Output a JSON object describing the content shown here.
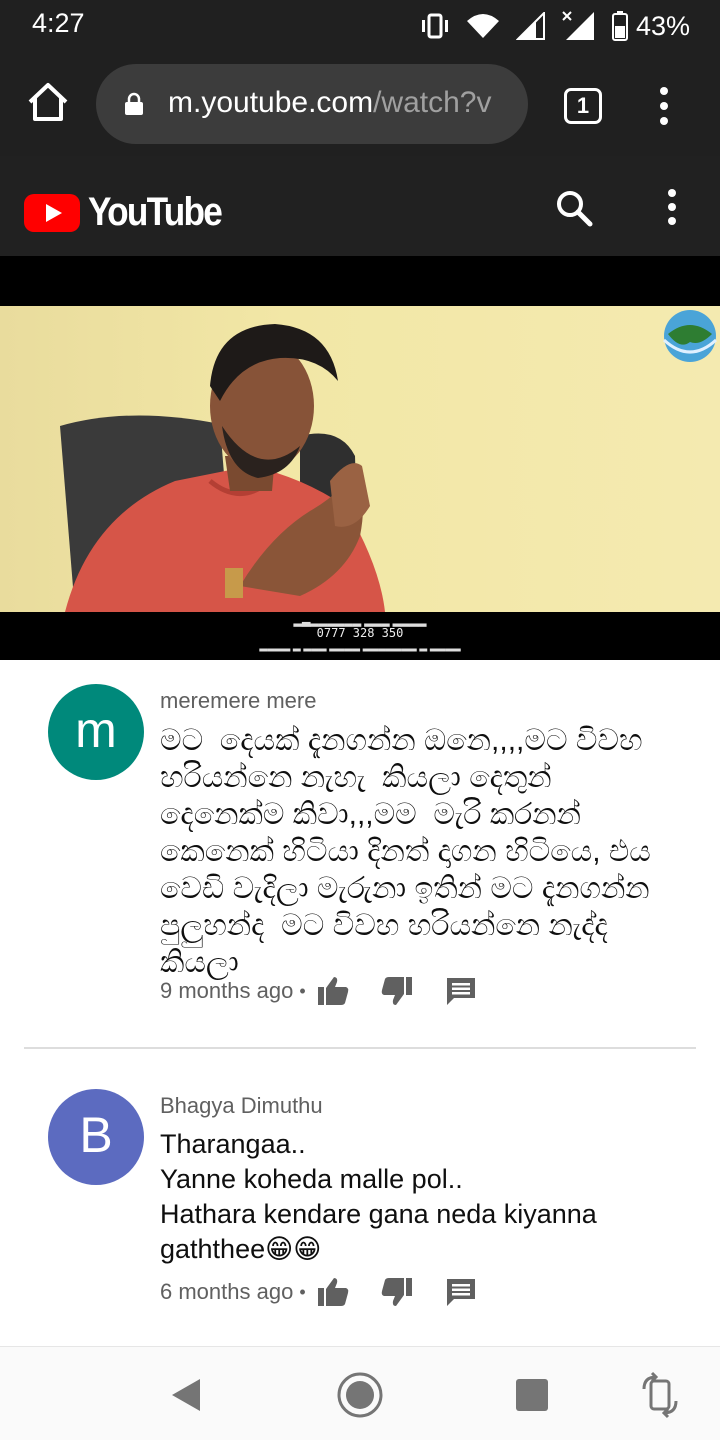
{
  "status_bar": {
    "time": "4:27",
    "battery": "43%",
    "icons": [
      "vibrate-icon",
      "wifi-icon",
      "signal-icon",
      "signal-x-icon",
      "battery-icon"
    ]
  },
  "browser": {
    "url_host": "m.youtube.com",
    "url_path": "/watch?v",
    "tab_count": "1",
    "icons": [
      "home-icon",
      "lock-icon",
      "tabs-icon",
      "more-vertical-icon"
    ]
  },
  "youtube": {
    "brand": "YouTube",
    "icons": [
      "youtube-logo-icon",
      "search-icon",
      "more-vertical-icon"
    ]
  },
  "video": {
    "caption_phone": "0777 328 350"
  },
  "comments": [
    {
      "avatar_letter": "m",
      "avatar_color": "#00897b",
      "author": "meremere mere",
      "text": "මට  දෙයක් දැනගන්න ඔනෙ,,,,මට විවහ හරියන්නෙ නැහැ  කියලා දෙතුන් දෙනෙක්ම කිවා,,,මම  මැරි කරනන් කෙනෙක් හිටියා දිනත් දාගන හිටියෙ, එය වෙඩි වැදිලා මැරුනා ඉතින් මට දැනගන්න පුලුහන්ද  මට විවහ හරියන්නෙ නැද්ද කියලා",
      "time": "9 months ago",
      "separator": "•"
    },
    {
      "avatar_letter": "B",
      "avatar_color": "#5c6bc0",
      "author": "Bhagya Dimuthu",
      "text": "Tharangaa..\nYanne koheda malle pol..\nHathara kendare gana neda kiyanna gaththee😁😁",
      "time": "6 months ago",
      "separator": "•"
    }
  ],
  "comment_actions": [
    "like-icon",
    "dislike-icon",
    "reply-icon"
  ],
  "nav_bar": [
    "back-icon",
    "home-circle-icon",
    "recents-icon",
    "rotate-icon"
  ]
}
